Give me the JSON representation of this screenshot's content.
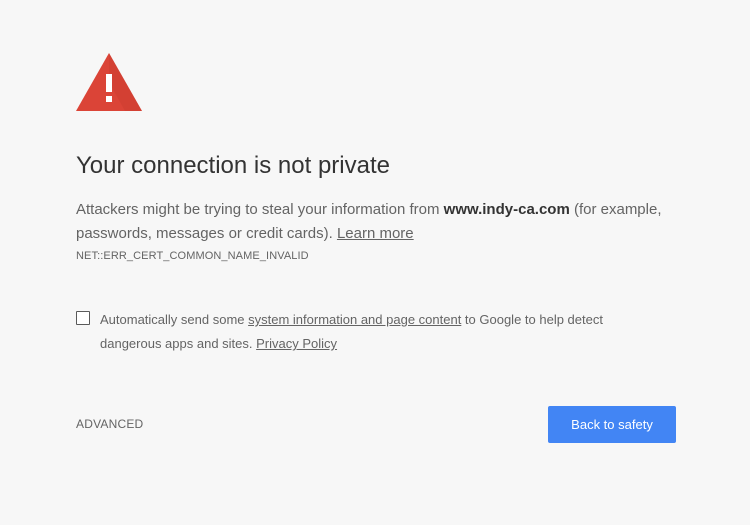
{
  "headline": "Your connection is not private",
  "explanation": {
    "prefix": "Attackers might be trying to steal your information from ",
    "domain": "www.indy-ca.com",
    "suffix": " (for example, passwords, messages or credit cards). ",
    "learn_more": "Learn more"
  },
  "error_code": "NET::ERR_CERT_COMMON_NAME_INVALID",
  "extended_reporting": {
    "checked": false,
    "prefix": "Automatically send some ",
    "link": "system information and page content",
    "middle": " to Google to help detect dangerous apps and sites. ",
    "privacy_link": "Privacy Policy"
  },
  "buttons": {
    "advanced": "ADVANCED",
    "back_to_safety": "Back to safety"
  },
  "icon": "warning-triangle-icon",
  "colors": {
    "background": "#f7f7f7",
    "warning_red": "#db4437",
    "primary_button": "#4285f4"
  }
}
